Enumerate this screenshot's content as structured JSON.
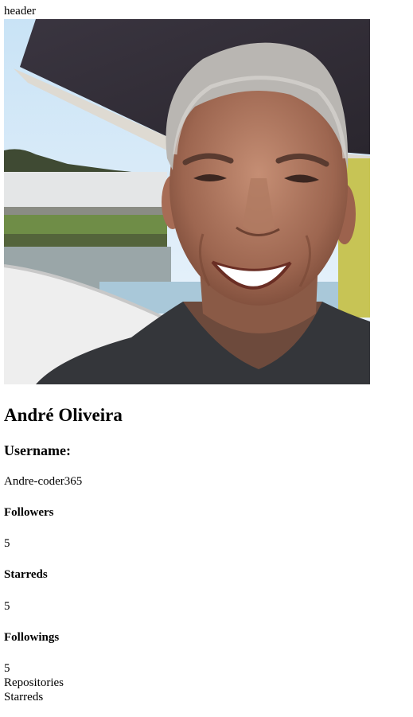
{
  "header": {
    "text": "header"
  },
  "profile": {
    "avatar_icon": "profile-photo",
    "name": "André Oliveira",
    "username_label": "Username:",
    "username": "Andre-coder365",
    "followers_label": "Followers",
    "followers": "5",
    "starreds_label": "Starreds",
    "starreds": "5",
    "followings_label": "Followings",
    "followings": "5"
  },
  "nav": {
    "repositories": "Repositories",
    "starreds": "Starreds"
  }
}
